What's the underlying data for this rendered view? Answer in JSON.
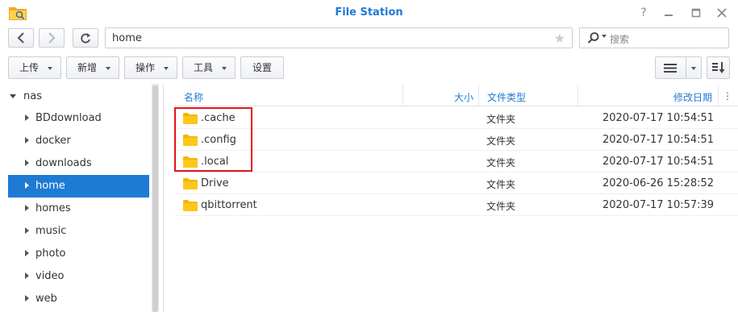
{
  "window": {
    "title": "File Station",
    "help": "?"
  },
  "nav": {
    "path": "home",
    "search_placeholder": "搜索"
  },
  "toolbar": {
    "upload": "上传",
    "new": "新增",
    "action": "操作",
    "tools": "工具",
    "settings": "设置"
  },
  "sidebar": {
    "root": "nas",
    "items": [
      {
        "label": "BDdownload"
      },
      {
        "label": "docker"
      },
      {
        "label": "downloads"
      },
      {
        "label": "home",
        "selected": true
      },
      {
        "label": "homes"
      },
      {
        "label": "music"
      },
      {
        "label": "photo"
      },
      {
        "label": "video"
      },
      {
        "label": "web"
      }
    ]
  },
  "table": {
    "columns": {
      "name": "名称",
      "size": "大小",
      "type": "文件类型",
      "modified": "修改日期"
    },
    "rows": [
      {
        "name": ".cache",
        "type": "文件夹",
        "modified": "2020-07-17 10:54:51"
      },
      {
        "name": ".config",
        "type": "文件夹",
        "modified": "2020-07-17 10:54:51"
      },
      {
        "name": ".local",
        "type": "文件夹",
        "modified": "2020-07-17 10:54:51"
      },
      {
        "name": "Drive",
        "type": "文件夹",
        "modified": "2020-06-26 15:28:52"
      },
      {
        "name": "qbittorrent",
        "type": "文件夹",
        "modified": "2020-07-17 10:57:39"
      }
    ]
  },
  "colors": {
    "accent": "#1f7ad3",
    "selection": "#1e7bd4",
    "folder": "#f5b400",
    "highlight": "#e0151e"
  }
}
